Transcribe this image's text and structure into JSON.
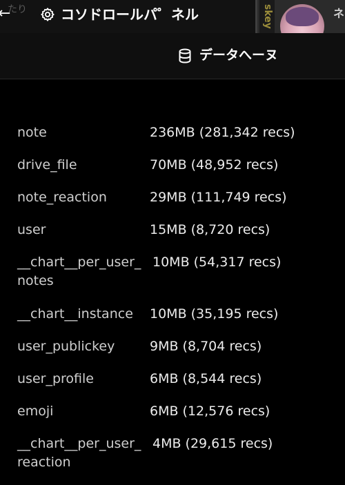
{
  "header": {
    "back_glyph": "←",
    "back_ghost_text": "たり",
    "title": "コソドロールパ゜ネル",
    "icon": "gear-icon",
    "side_text": "skey",
    "side_edge_text": "ネ"
  },
  "section": {
    "title": "データへーヌ",
    "icon": "database-icon"
  },
  "tables": [
    {
      "name": "note",
      "size": "236MB (281,342 recs)"
    },
    {
      "name": "drive_file",
      "size": "70MB (48,952 recs)"
    },
    {
      "name": "note_reaction",
      "size": "29MB (111,749 recs)"
    },
    {
      "name": "user",
      "size": "15MB (8,720 recs)"
    },
    {
      "name": "__chart__per_user_notes",
      "size": "10MB (54,317 recs)"
    },
    {
      "name": "__chart__instance",
      "size": "10MB (35,195 recs)"
    },
    {
      "name": "user_publickey",
      "size": "9MB (8,704 recs)"
    },
    {
      "name": "user_profile",
      "size": "6MB (8,544 recs)"
    },
    {
      "name": "emoji",
      "size": "6MB (12,576 recs)"
    },
    {
      "name": "__chart__per_user_reaction",
      "size": "4MB (29,615 recs)"
    }
  ],
  "colors": {
    "background": "#000000",
    "header_bg": "#121212",
    "text": "#e6e6e6",
    "name_text": "#cfcfcf"
  }
}
